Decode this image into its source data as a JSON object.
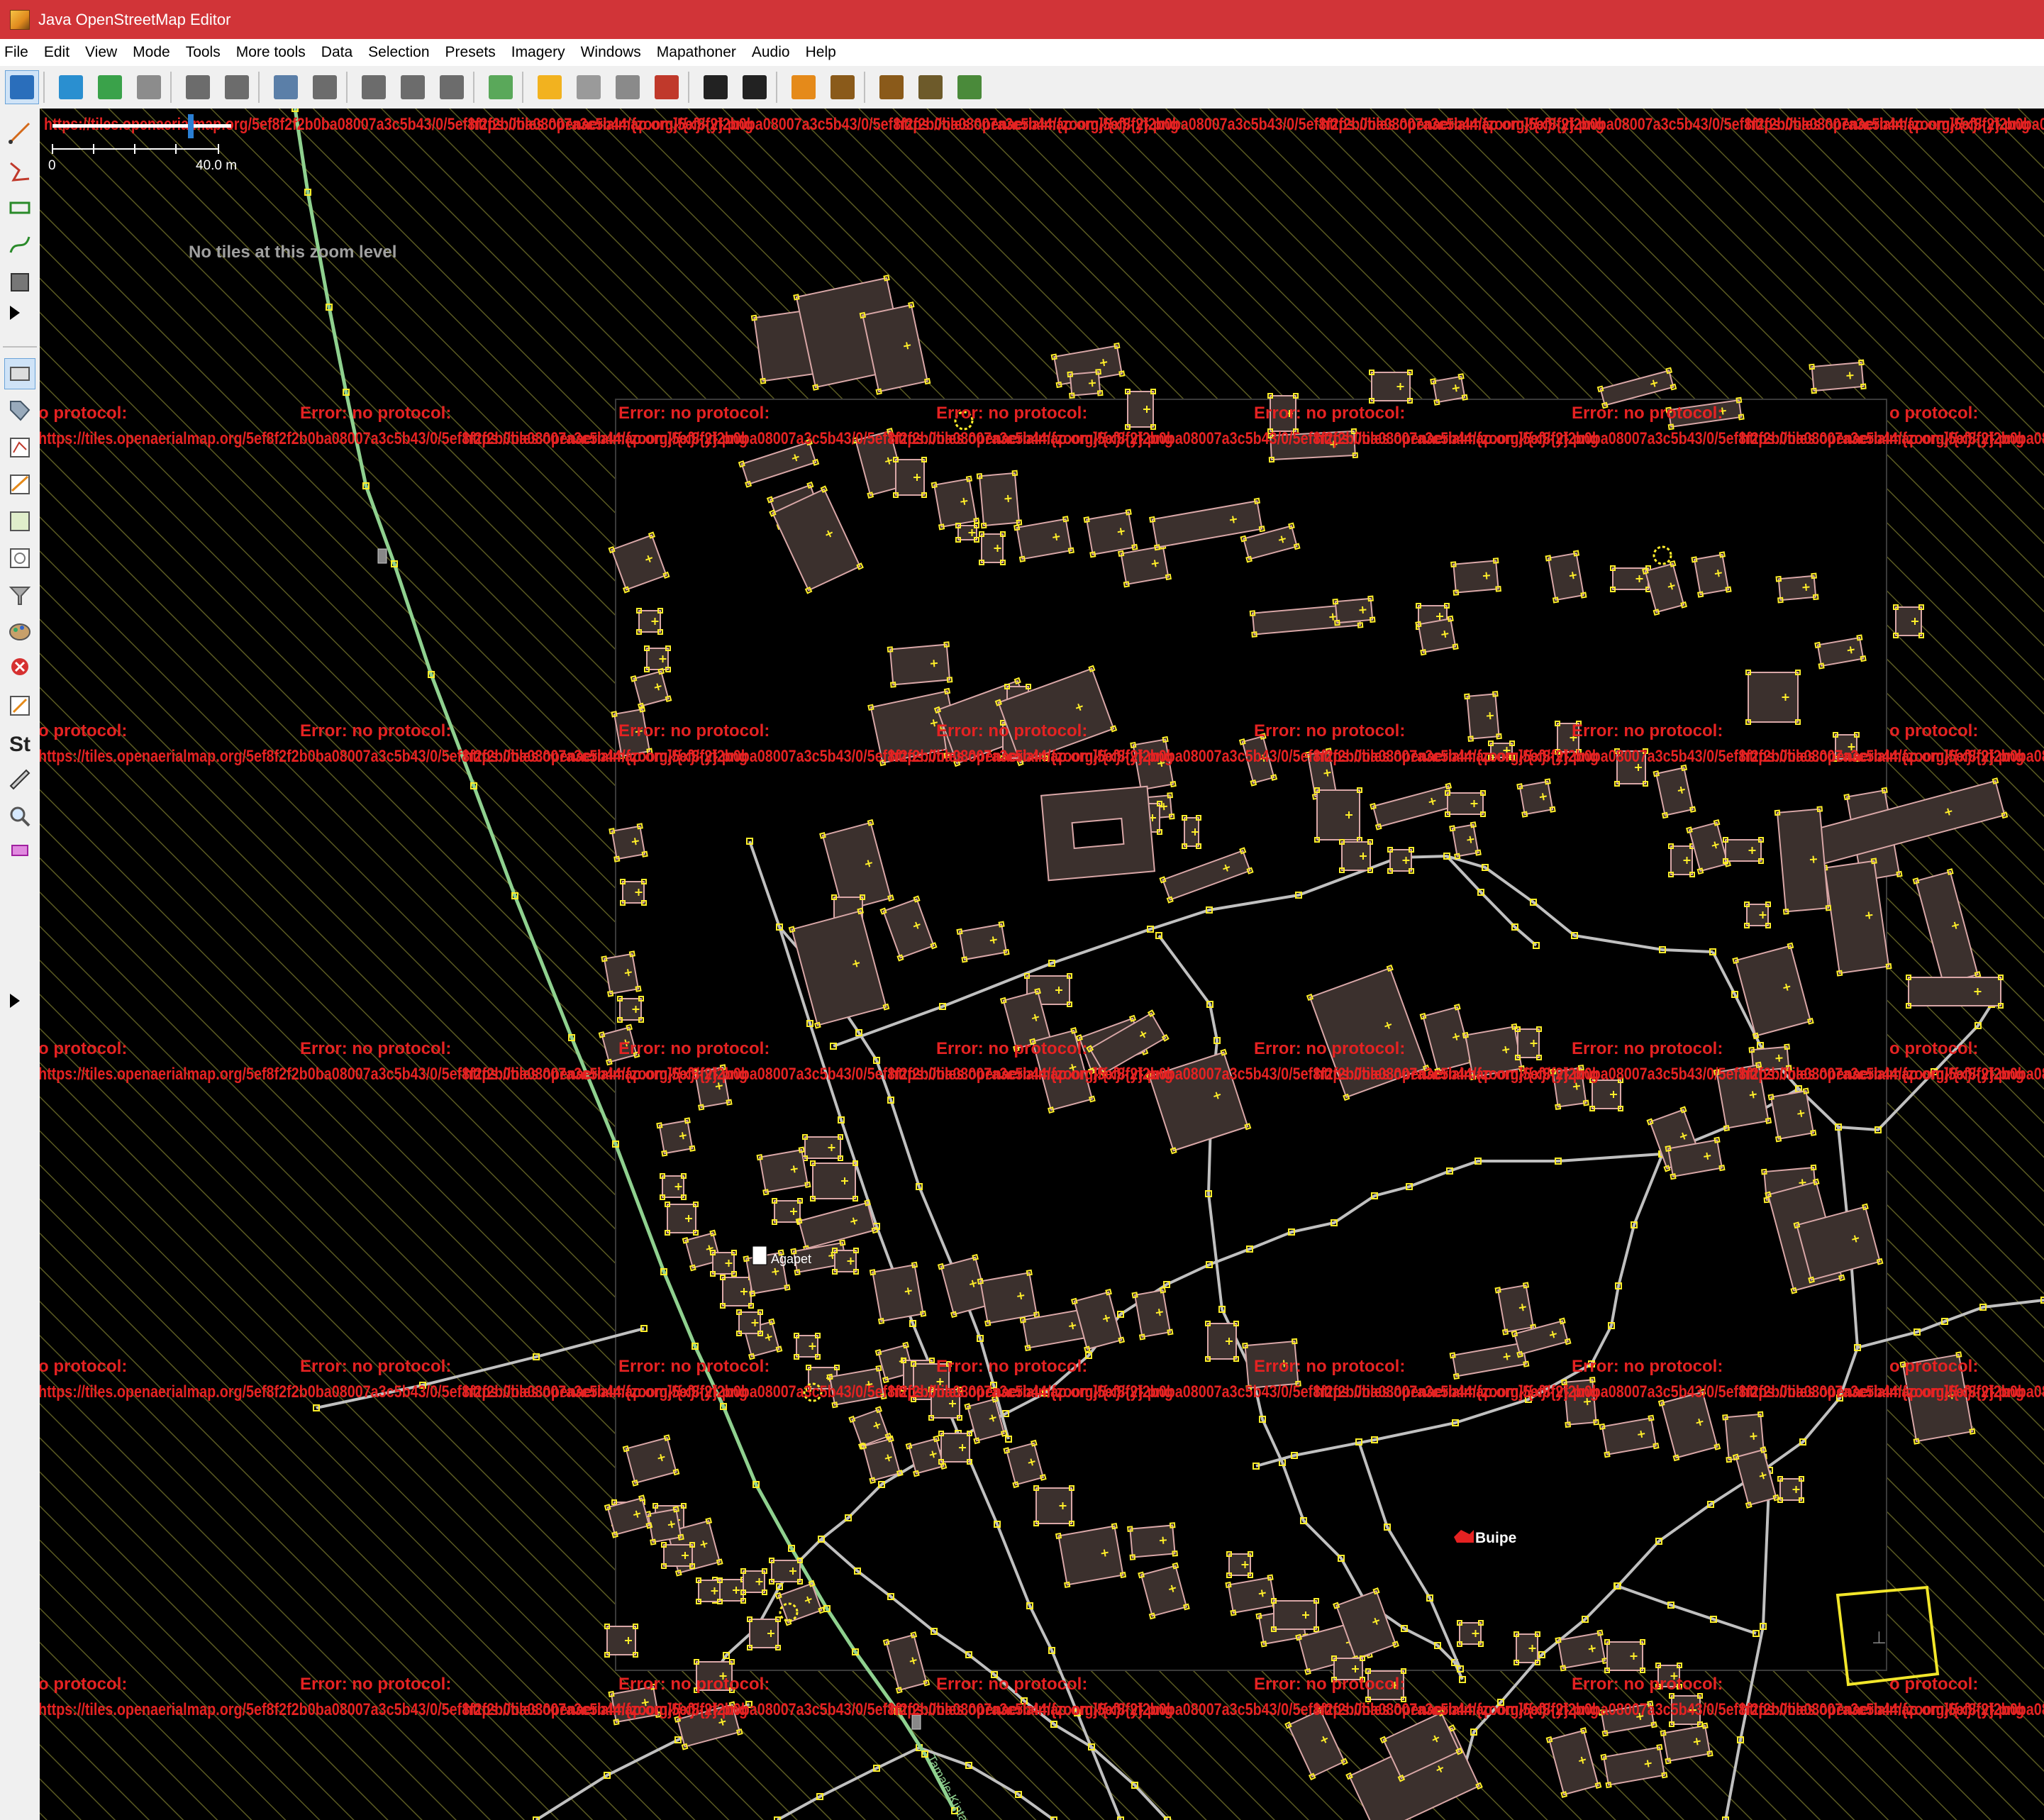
{
  "window": {
    "title": "Java OpenStreetMap Editor"
  },
  "menu": [
    "File",
    "Edit",
    "View",
    "Mode",
    "Tools",
    "More tools",
    "Data",
    "Selection",
    "Presets",
    "Imagery",
    "Windows",
    "Mapathoner",
    "Audio",
    "Help"
  ],
  "toolbar": {
    "buttons": [
      {
        "name": "open-icon",
        "color": "#2a6ebb"
      },
      {
        "name": "save-icon",
        "color": "#2a8fd0"
      },
      {
        "name": "download-icon",
        "color": "#3aa24a"
      },
      {
        "name": "upload-icon",
        "color": "#8c8c8c"
      },
      {
        "name": "undo-icon",
        "color": "#6c6c6c"
      },
      {
        "name": "redo-icon",
        "color": "#6c6c6c"
      },
      {
        "name": "zoom-preferences-icon",
        "color": "#5b7fa8"
      },
      {
        "name": "preferences-icon",
        "color": "#6c6c6c"
      },
      {
        "name": "split-way-icon",
        "color": "#6c6c6c"
      },
      {
        "name": "combine-way-icon",
        "color": "#6c6c6c"
      },
      {
        "name": "reverse-icon",
        "color": "#6c6c6c"
      },
      {
        "name": "align-icon",
        "color": "#5aa85a"
      },
      {
        "name": "highway-preset-icon",
        "color": "#f2b21f"
      },
      {
        "name": "railway-preset-icon",
        "color": "#9a9a9a"
      },
      {
        "name": "waterway-preset-icon",
        "color": "#8a8a8a"
      },
      {
        "name": "building-preset-icon",
        "color": "#c0392b"
      },
      {
        "name": "car-preset-icon",
        "color": "#222222"
      },
      {
        "name": "bus-preset-icon",
        "color": "#222222"
      },
      {
        "name": "amenity-preset-icon",
        "color": "#e58a1a"
      },
      {
        "name": "food-preset-icon",
        "color": "#8a5a1a"
      },
      {
        "name": "tourism-preset-icon",
        "color": "#8a5a1a"
      },
      {
        "name": "industrial-preset-icon",
        "color": "#6d5a2a"
      },
      {
        "name": "recycling-preset-icon",
        "color": "#4a8a3a"
      }
    ]
  },
  "map": {
    "no_tiles_text": "No tiles at this zoom level",
    "scale": {
      "start": "0",
      "end": "40.0 m"
    },
    "error_text": "Error: no protocol:",
    "error_text_partial": "o protocol:",
    "url_text": "https://tiles.openaerialmap.org/5ef8f2f2b0ba08007a3c5b43/0/5ef8f2f2b0ba08007a3c5b44/{zoom}/{x}/{y}.png",
    "labels": [
      {
        "text": "Agapet"
      },
      {
        "text": "Buipe"
      }
    ],
    "road_name": "Tamale-Kintampo Road"
  },
  "colors": {
    "titlebar": "#d13438",
    "building_fill": "#3b302d",
    "building_stroke": "#d9a7a7",
    "node": "#ffee2a",
    "road": "#c0c0c0",
    "trunk": "#8fd18f",
    "error": "#e52222",
    "hatch": "#5a5a22"
  }
}
